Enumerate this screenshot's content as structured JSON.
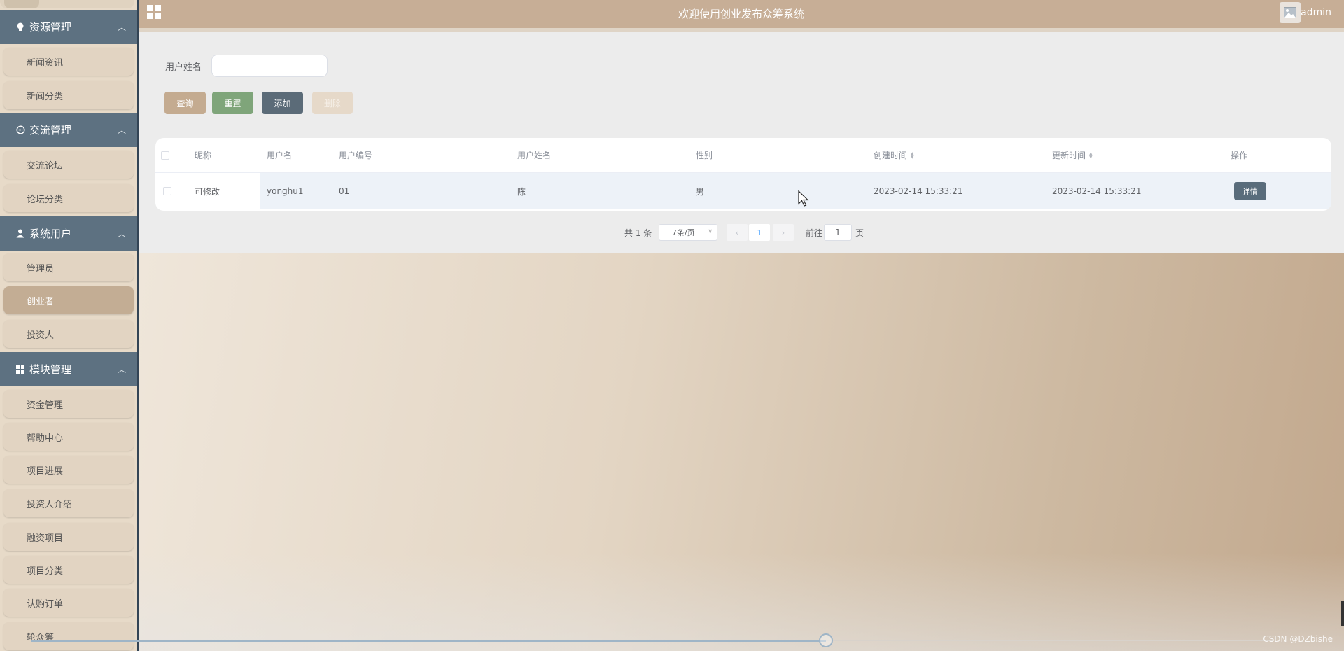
{
  "header": {
    "title": "欢迎使用创业发布众筹系统",
    "username": "admin"
  },
  "sidebar": {
    "groups": [
      {
        "label": "资源管理",
        "icon": "bulb-icon",
        "items": [
          "新闻资讯",
          "新闻分类"
        ]
      },
      {
        "label": "交流管理",
        "icon": "chat-icon",
        "items": [
          "交流论坛",
          "论坛分类"
        ]
      },
      {
        "label": "系统用户",
        "icon": "user-icon",
        "items": [
          "管理员",
          "创业者",
          "投资人"
        ]
      },
      {
        "label": "模块管理",
        "icon": "grid-icon",
        "items": [
          "资金管理",
          "帮助中心",
          "项目进展",
          "投资人介绍",
          "融资项目",
          "项目分类",
          "认购订单",
          "轮众筹"
        ]
      }
    ],
    "active_item": "创业者"
  },
  "search": {
    "label": "用户姓名",
    "value": ""
  },
  "buttons": {
    "query": "查询",
    "reset": "重置",
    "add": "添加",
    "delete": "删除"
  },
  "table": {
    "columns": [
      "昵称",
      "用户名",
      "用户编号",
      "用户姓名",
      "性别",
      "创建时间",
      "更新时间",
      "操作"
    ],
    "rows": [
      {
        "nickname": "可修改",
        "username": "yonghu1",
        "user_no": "01",
        "real_name": "陈",
        "gender": "男",
        "created": "2023-02-14 15:33:21",
        "updated": "2023-02-14 15:33:21",
        "action": "详情"
      }
    ]
  },
  "pagination": {
    "total": "共 1 条",
    "page_size": "7条/页",
    "current_page": "1",
    "goto_label": "前往",
    "goto_value": "1",
    "page_unit": "页"
  },
  "watermark": "CSDN @DZbishe",
  "colors": {
    "sidebar_header": "#5d7181",
    "topbar": "#c7ae96",
    "active_item": "#c3ad94",
    "btn_reset": "#7fa57a",
    "btn_add": "#5b6b78"
  }
}
